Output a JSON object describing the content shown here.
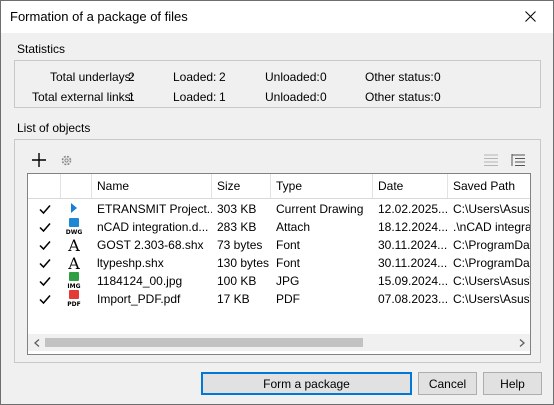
{
  "window": {
    "title": "Formation of a package of files"
  },
  "statistics": {
    "label": "Statistics",
    "rows": [
      {
        "total_label": "Total underlays:",
        "total": "2",
        "loaded_label": "Loaded:",
        "loaded": "2",
        "unloaded_label": "Unloaded:",
        "unloaded": "0",
        "other_label": "Other status:",
        "other": "0"
      },
      {
        "total_label": "Total external links:",
        "total": "1",
        "loaded_label": "Loaded:",
        "loaded": "1",
        "unloaded_label": "Unloaded:",
        "unloaded": "0",
        "other_label": "Other status:",
        "other": "0"
      }
    ]
  },
  "list": {
    "label": "List of objects",
    "columns": [
      "",
      "",
      "Name",
      "Size",
      "Type",
      "Date",
      "Saved Path"
    ],
    "rows": [
      {
        "icon": "play-icon",
        "name": "ETRANSMIT Project...",
        "size": "303 KB",
        "type": "Current Drawing",
        "date": "12.02.2025...",
        "path": "C:\\Users\\Asus\\"
      },
      {
        "icon": "dwg-file-icon",
        "icon_text": "DWG",
        "name": "nCAD integration.d...",
        "size": "283 KB",
        "type": "Attach",
        "date": "18.12.2024...",
        "path": ".\\nCAD integra"
      },
      {
        "icon": "font-icon",
        "icon_text": "A",
        "name": "GOST 2.303-68.shx",
        "size": "73 bytes",
        "type": "Font",
        "date": "30.11.2024...",
        "path": "C:\\ProgramDat"
      },
      {
        "icon": "font-icon",
        "icon_text": "A",
        "name": "ltypeshp.shx",
        "size": "130 bytes",
        "type": "Font",
        "date": "30.11.2024...",
        "path": "C:\\ProgramDat"
      },
      {
        "icon": "img-file-icon",
        "icon_text": "IMG",
        "name": "1184124_00.jpg",
        "size": "100 KB",
        "type": "JPG",
        "date": "15.09.2024...",
        "path": "C:\\Users\\Asus\\"
      },
      {
        "icon": "pdf-file-icon",
        "icon_text": "PDF",
        "name": "Import_PDF.pdf",
        "size": "17 KB",
        "type": "PDF",
        "date": "07.08.2023...",
        "path": "C:\\Users\\Asus\\"
      }
    ]
  },
  "buttons": {
    "form": "Form a package",
    "cancel": "Cancel",
    "help": "Help"
  },
  "colors": {
    "accent": "#0078d7",
    "dwg": "#1e88d4",
    "img": "#2ea043",
    "pdf": "#e53935",
    "play": "#1a7fd4"
  }
}
